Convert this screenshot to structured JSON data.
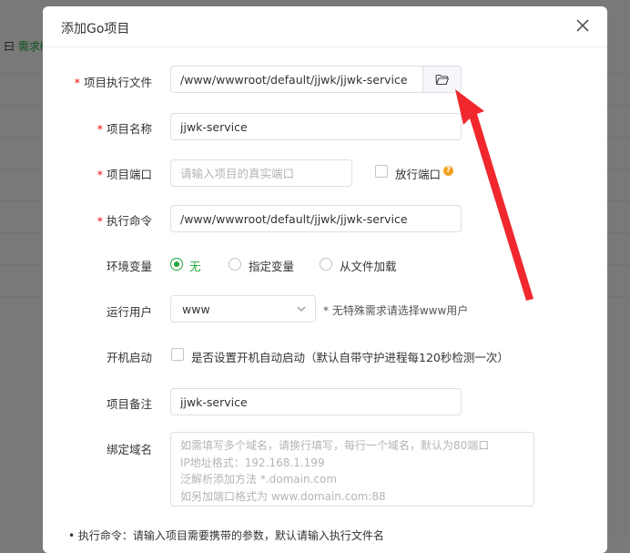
{
  "background": {
    "snippet_prefix": "曰",
    "snippet_green": "需求ł"
  },
  "modal": {
    "title": "添加Go项目",
    "fields": {
      "exec_file": {
        "label": "项目执行文件",
        "value": "/www/wwwroot/default/jjwk/jjwk-service",
        "required": true
      },
      "name": {
        "label": "项目名称",
        "value": "jjwk-service",
        "required": true
      },
      "port": {
        "label": "项目端口",
        "placeholder": "请输入项目的真实端口",
        "required": true,
        "open_port_label": "放行端口"
      },
      "command": {
        "label": "执行命令",
        "value": "/www/wwwroot/default/jjwk/jjwk-service",
        "required": true
      },
      "env": {
        "label": "环境变量",
        "options": [
          "无",
          "指定变量",
          "从文件加载"
        ],
        "selected": "无"
      },
      "run_user": {
        "label": "运行用户",
        "value": "www",
        "hint": "* 无特殊需求请选择www用户"
      },
      "autostart": {
        "label": "开机启动",
        "checkbox_label": "是否设置开机自动启动（默认自带守护进程每120秒检测一次）"
      },
      "remark": {
        "label": "项目备注",
        "value": "jjwk-service"
      },
      "domain": {
        "label": "绑定域名",
        "placeholder_lines": [
          "如需填写多个域名，请换行填写，每行一个域名，默认为80端口",
          "IP地址格式：192.168.1.199",
          "泛解析添加方法 *.domain.com",
          "如另加端口格式为 www.domain.com:88"
        ]
      }
    },
    "footnote": "• 执行命令：请输入项目需要携带的参数，默认请输入执行文件名"
  },
  "colors": {
    "accent_green": "#20a53a",
    "required_red": "#ef0808",
    "arrow_red": "#f0282d"
  }
}
